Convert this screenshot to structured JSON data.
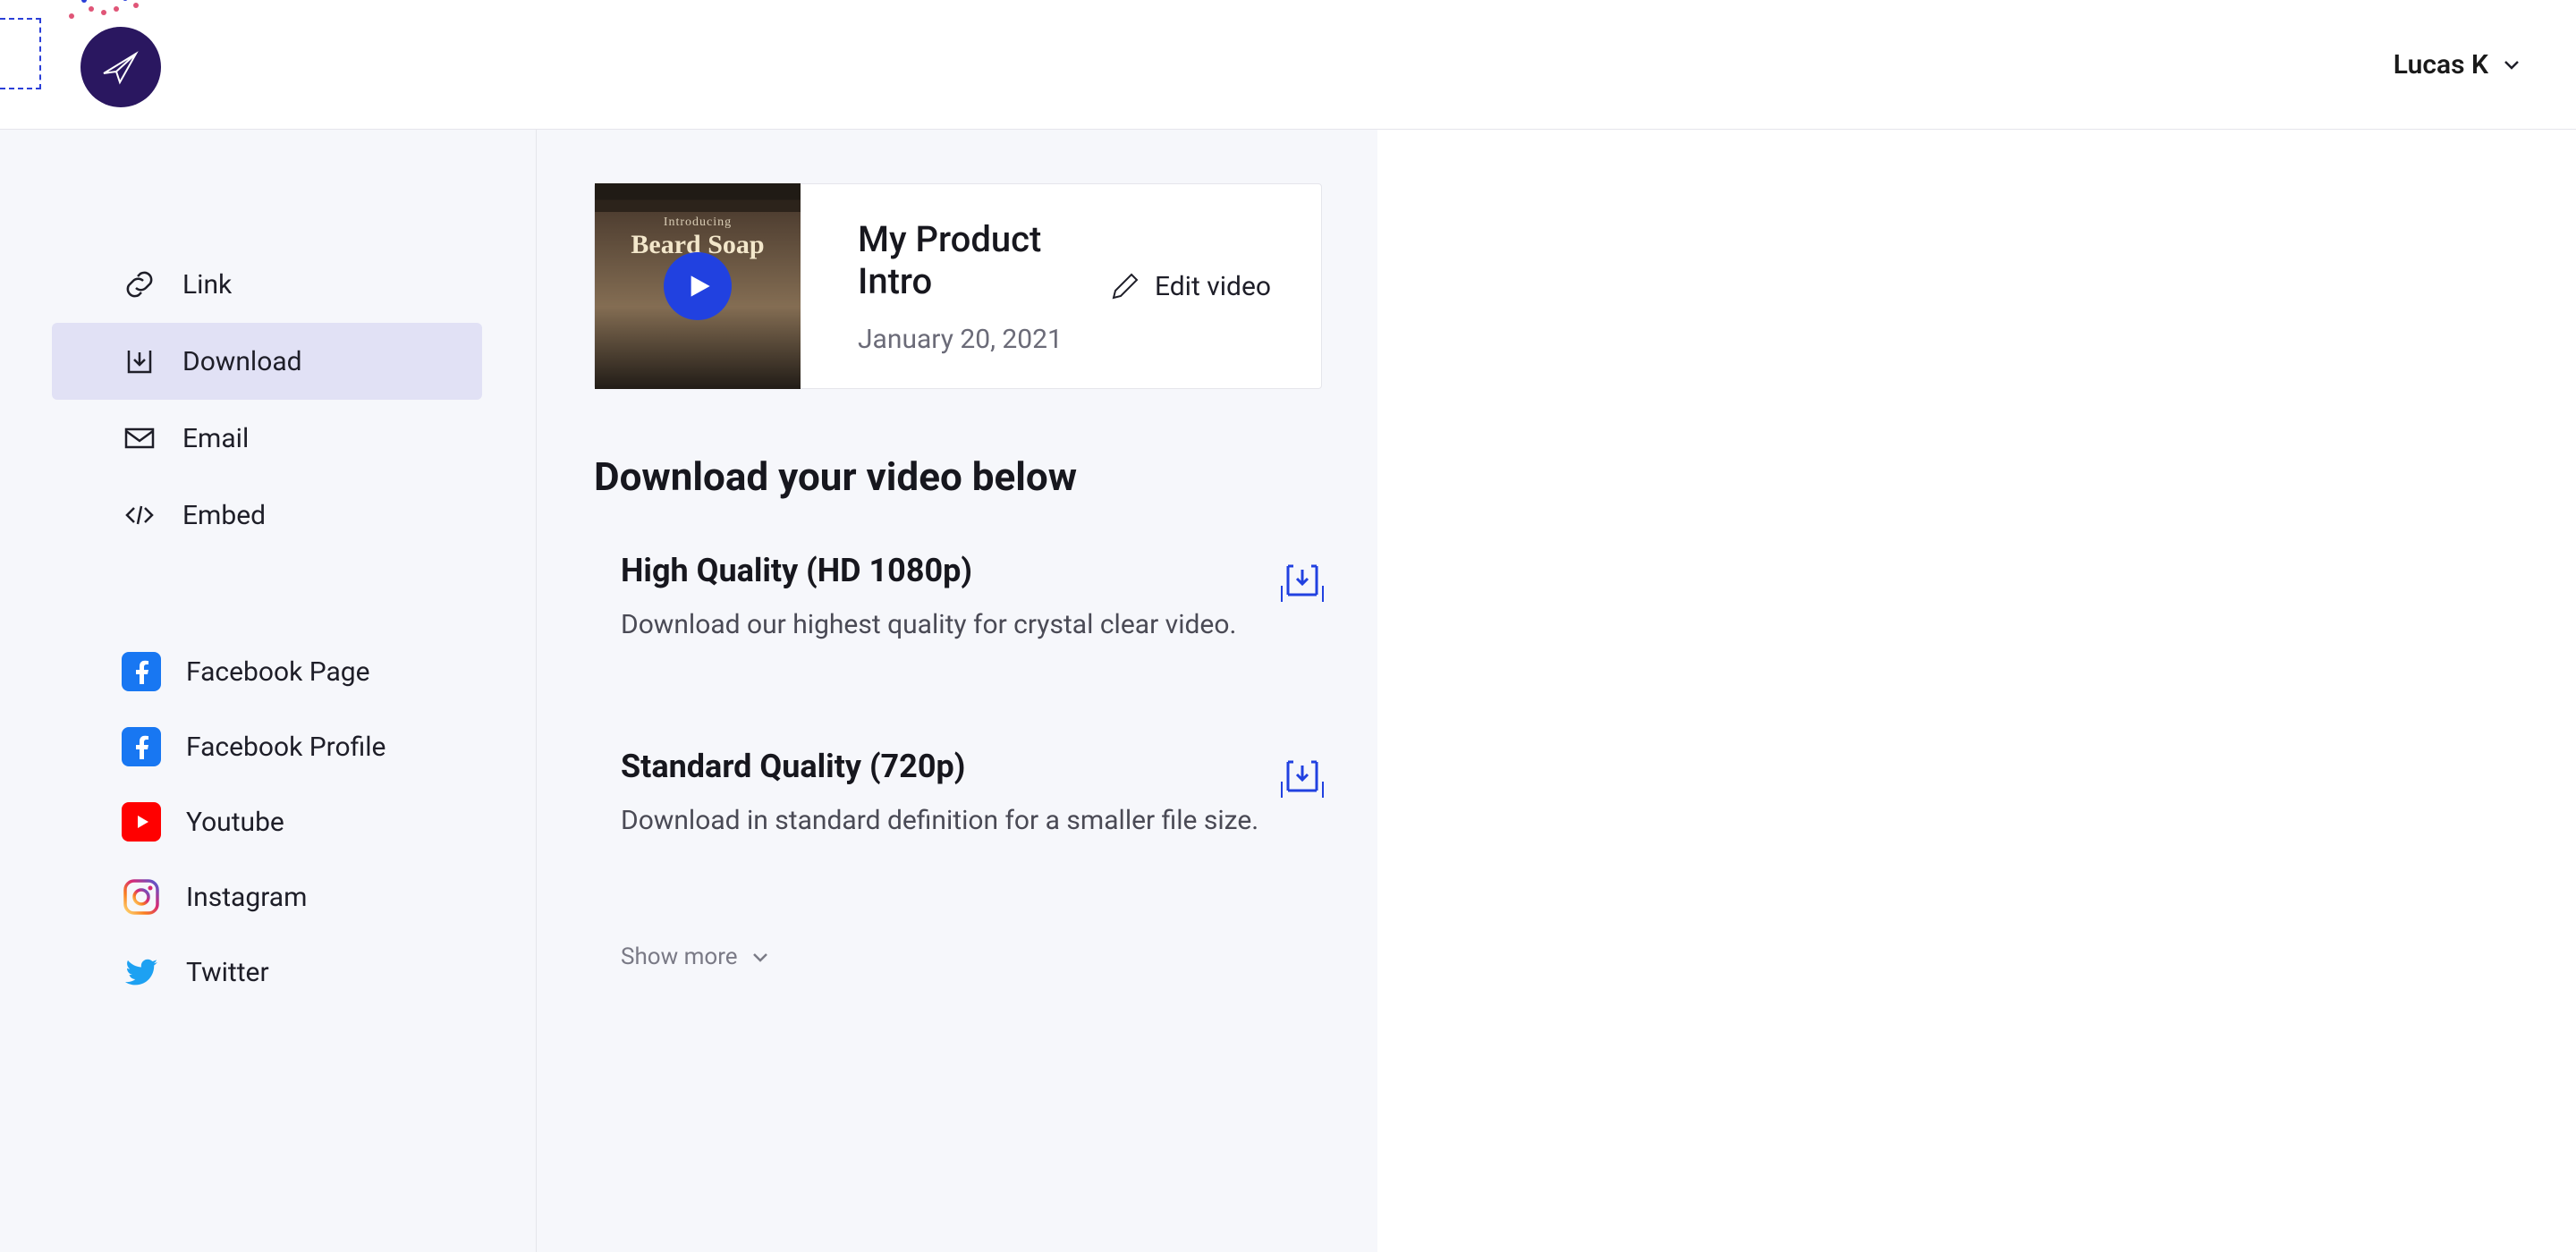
{
  "header": {
    "user_name": "Lucas K"
  },
  "sidebar": {
    "primary": [
      {
        "label": "Link"
      },
      {
        "label": "Download"
      },
      {
        "label": "Email"
      },
      {
        "label": "Embed"
      }
    ],
    "social": [
      {
        "label": "Facebook Page"
      },
      {
        "label": "Facebook Profile"
      },
      {
        "label": "Youtube"
      },
      {
        "label": "Instagram"
      },
      {
        "label": "Twitter"
      }
    ],
    "active_index": 1
  },
  "video": {
    "title": "My Product Intro",
    "date": "January 20, 2021",
    "thumbnail_small": "Introducing",
    "thumbnail_big": "Beard Soap",
    "edit_label": "Edit video"
  },
  "download": {
    "heading": "Download your video below",
    "options": [
      {
        "title": "High Quality (HD 1080p)",
        "description": "Download our highest quality for crystal clear video."
      },
      {
        "title": "Standard Quality (720p)",
        "description": "Download in standard definition for a smaller file size."
      }
    ],
    "show_more_label": "Show more"
  }
}
